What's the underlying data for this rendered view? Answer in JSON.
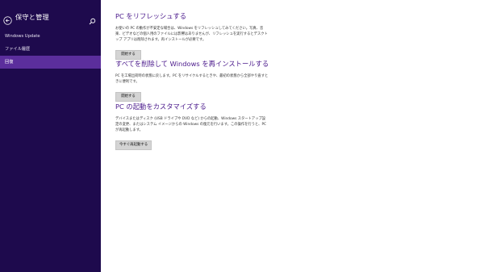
{
  "sidebar": {
    "title": "保守と管理",
    "back_icon": "back-arrow-icon",
    "search_icon": "search-icon",
    "items": [
      {
        "label": "Windows Update",
        "selected": false
      },
      {
        "label": "ファイル履歴",
        "selected": false
      },
      {
        "label": "回復",
        "selected": true
      }
    ]
  },
  "sections": [
    {
      "title": "PC をリフレッシュする",
      "description": "お使いの PC の動作が不安定な場合は、Windows をリフレッシュしてみてください。写真、音楽、ビデオなどの個人用のファイルには影響はありませんが、リフレッシュを実行するとデスクトップ アプリは削除されます。再インストールが必要です。",
      "button": "開始する"
    },
    {
      "title": "すべてを削除して Windows を再インストールする",
      "description": "PC を工場出荷時の状態に戻します。PC をリサイクルするときや、最初の状態から全部やり直すときに便利です。",
      "button": "開始する"
    },
    {
      "title": "PC の起動をカスタマイズする",
      "description": "デバイスまたはディスク (USB ドライブや DVD など) からの起動、Windows スタートアップ設定の変更、またはシステム イメージからの Windows の復元を行います。この操作を行うと、PC が再起動します。",
      "button": "今すぐ再起動する"
    }
  ],
  "colors": {
    "sidebar_bg": "#1e0a4d",
    "sidebar_selected": "#5b2e9c",
    "heading": "#4b1a8c",
    "button_bg": "#d4d4d4"
  }
}
